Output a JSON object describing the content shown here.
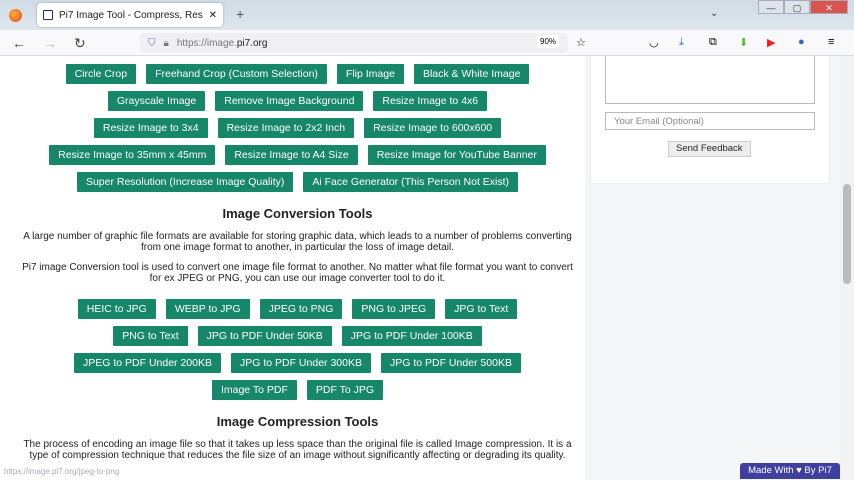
{
  "browser": {
    "tab_title": "Pi7 Image Tool - Compress, Res",
    "url_prefix": "https://image.",
    "url_domain": "pi7.org",
    "zoom": "90%",
    "status_url": "https://image.pi7.org/jpeg-to-png"
  },
  "edit_rows": [
    [
      "Circle Crop",
      "Freehand Crop (Custom Selection)",
      "Flip Image",
      "Black & White Image"
    ],
    [
      "Grayscale Image",
      "Remove Image Background",
      "Resize Image to 4x6"
    ],
    [
      "Resize Image to 3x4",
      "Resize Image to 2x2 Inch",
      "Resize Image to 600x600"
    ],
    [
      "Resize Image to 35mm x 45mm",
      "Resize Image to A4 Size",
      "Resize Image for YouTube Banner"
    ],
    [
      "Super Resolution (Increase Image Quality)",
      "Ai Face Generator (This Person Not Exist)"
    ]
  ],
  "conversion": {
    "title": "Image Conversion Tools",
    "p1": "A large number of graphic file formats are available for storing graphic data, which leads to a number of problems converting from one image format to another, in particular the loss of image detail.",
    "p2": "Pi7 image Conversion tool is used to convert one image file format to another. No matter what file format you want to convert for ex JPEG or PNG, you can use our image converter tool to do it.",
    "rows": [
      [
        "HEIC to JPG",
        "WEBP to JPG",
        "JPEG to PNG",
        "PNG to JPEG",
        "JPG to Text"
      ],
      [
        "PNG to Text",
        "JPG to PDF Under 50KB",
        "JPG to PDF Under 100KB"
      ],
      [
        "JPEG to PDF Under 200KB",
        "JPG to PDF Under 300KB",
        "JPG to PDF Under 500KB"
      ],
      [
        "Image To PDF",
        "PDF To JPG"
      ]
    ]
  },
  "compression": {
    "title": "Image Compression Tools",
    "p1": "The process of encoding an image file so that it takes up less space than the original file is called Image compression. It is a type of compression technique that reduces the file size of an image without significantly affecting or degrading its quality."
  },
  "sidebar": {
    "email_placeholder": "Your Email (Optional)",
    "send_label": "Send Feedback"
  },
  "made_with": "Made With ♥ By  Pi7",
  "accent": "#17876a"
}
